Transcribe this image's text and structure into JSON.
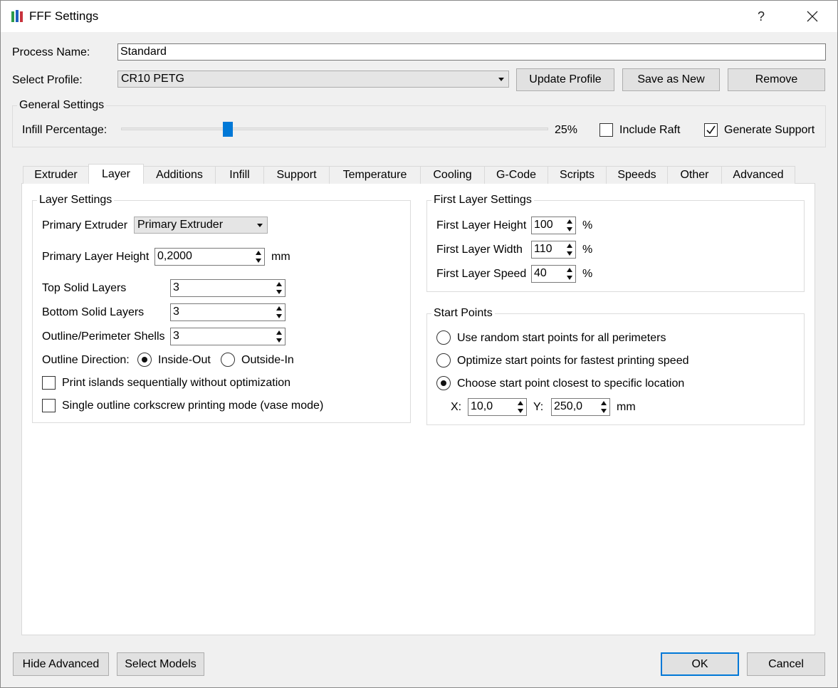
{
  "window": {
    "title": "FFF Settings",
    "help_glyph": "?",
    "icons": [
      "app-icon",
      "close-icon"
    ]
  },
  "process": {
    "name_label": "Process Name:",
    "name_value": "Standard",
    "profile_label": "Select Profile:",
    "profile_value": "CR10 PETG",
    "update_label": "Update Profile",
    "save_new_label": "Save as New",
    "remove_label": "Remove"
  },
  "general": {
    "title": "General Settings",
    "infill_label": "Infill Percentage:",
    "infill_fraction": 0.25,
    "infill_text": "25%",
    "include_raft_label": "Include Raft",
    "include_raft": false,
    "generate_support_label": "Generate Support",
    "generate_support": true
  },
  "tabs": [
    {
      "label": "Extruder"
    },
    {
      "label": "Layer"
    },
    {
      "label": "Additions"
    },
    {
      "label": "Infill"
    },
    {
      "label": "Support"
    },
    {
      "label": "Temperature"
    },
    {
      "label": "Cooling"
    },
    {
      "label": "G-Code"
    },
    {
      "label": "Scripts"
    },
    {
      "label": "Speeds"
    },
    {
      "label": "Other"
    },
    {
      "label": "Advanced"
    }
  ],
  "active_tab": "Layer",
  "layer": {
    "title": "Layer Settings",
    "primary_extruder_label": "Primary Extruder",
    "primary_extruder_value": "Primary Extruder",
    "layer_height_label": "Primary Layer Height",
    "layer_height_value": "0,2000",
    "layer_height_unit": "mm",
    "top_solid_label": "Top Solid Layers",
    "top_solid_value": "3",
    "bottom_solid_label": "Bottom Solid Layers",
    "bottom_solid_value": "3",
    "shells_label": "Outline/Perimeter Shells",
    "shells_value": "3",
    "direction_label": "Outline Direction:",
    "inside_out_label": "Inside-Out",
    "outside_in_label": "Outside-In",
    "direction_selected": "Inside-Out",
    "islands_label": "Print islands sequentially without optimization",
    "islands_checked": false,
    "vase_label": "Single outline corkscrew printing mode (vase mode)",
    "vase_checked": false
  },
  "first_layer": {
    "title": "First Layer Settings",
    "height_label": "First Layer Height",
    "height_value": "100",
    "width_label": "First Layer Width",
    "width_value": "110",
    "speed_label": "First Layer Speed",
    "speed_value": "40",
    "unit": "%"
  },
  "start_points": {
    "title": "Start Points",
    "random_label": "Use random start points for all perimeters",
    "optimize_label": "Optimize start points for fastest printing speed",
    "specific_label": "Choose start point closest to specific location",
    "selected": "specific",
    "x_label": "X:",
    "x_value": "10,0",
    "y_label": "Y:",
    "y_value": "250,0",
    "unit": "mm"
  },
  "footer": {
    "hide_advanced": "Hide Advanced",
    "select_models": "Select Models",
    "ok": "OK",
    "cancel": "Cancel"
  },
  "colors": {
    "accent": "#0078d7",
    "window_bg": "#f0f0f0",
    "pane_bg": "#ffffff"
  }
}
